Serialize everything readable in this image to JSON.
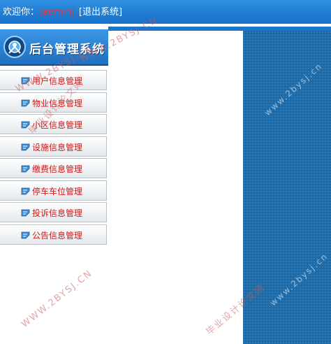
{
  "header": {
    "welcome_prefix": "欢迎你：",
    "username": "[admin]",
    "logout_label": "[退出系统]"
  },
  "sidebar": {
    "title": "后台管理系统",
    "items": [
      {
        "label": "用户信息管理"
      },
      {
        "label": "物业信息管理"
      },
      {
        "label": "小区信息管理"
      },
      {
        "label": "设施信息管理"
      },
      {
        "label": "缴费信息管理"
      },
      {
        "label": "停车车位管理"
      },
      {
        "label": "投诉信息管理"
      },
      {
        "label": "公告信息管理"
      }
    ]
  },
  "watermarks": {
    "site": "WWW.2BYSJ.CN",
    "site_lower": "www.2bysj.cn",
    "cn_text": "毕业设计论文网"
  },
  "colors": {
    "header_blue": "#1670c8",
    "menu_label_red": "#d01818",
    "username_red": "#ff2a2a",
    "right_panel_blue": "#1d6aa8"
  }
}
